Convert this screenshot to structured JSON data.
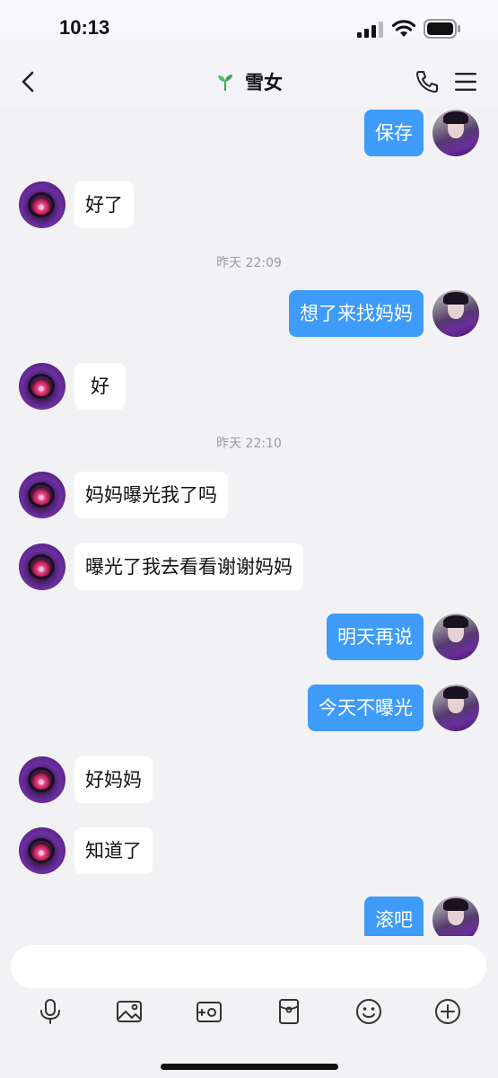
{
  "status": {
    "time": "10:13"
  },
  "nav": {
    "title": "雪女"
  },
  "messages": [
    {
      "side": "me",
      "text": "保存"
    },
    {
      "side": "other",
      "text": "好了"
    },
    {
      "timestamp": "昨天 22:09"
    },
    {
      "side": "me",
      "text": "想了来找妈妈"
    },
    {
      "side": "other",
      "text": "好"
    },
    {
      "timestamp": "昨天 22:10"
    },
    {
      "side": "other",
      "text": "妈妈曝光我了吗"
    },
    {
      "side": "other",
      "text": "曝光了我去看看谢谢妈妈"
    },
    {
      "side": "me",
      "text": "明天再说"
    },
    {
      "side": "me",
      "text": "今天不曝光"
    },
    {
      "side": "other",
      "text": "好妈妈"
    },
    {
      "side": "other",
      "text": "知道了"
    },
    {
      "side": "me",
      "text": "滚吧"
    }
  ],
  "input": {
    "placeholder": ""
  },
  "toolbar": {
    "icons": [
      "microphone-icon",
      "image-icon",
      "camera-icon",
      "red-packet-icon",
      "emoji-icon",
      "plus-icon"
    ]
  },
  "colors": {
    "my_bubble": "#3e9bf7",
    "other_bubble": "#ffffff",
    "background": "#f2f2f4"
  }
}
